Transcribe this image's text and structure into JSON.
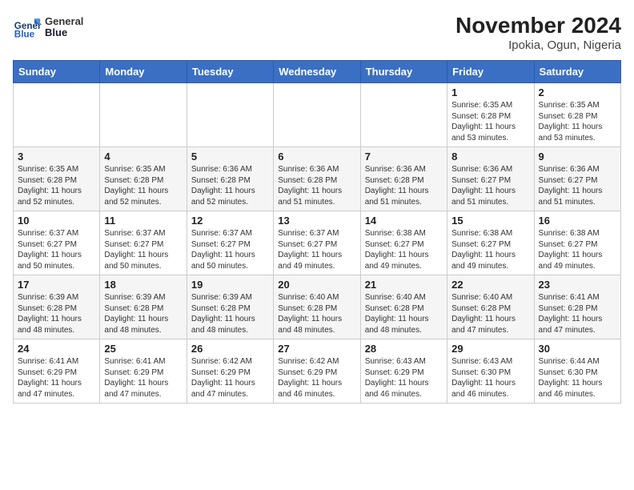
{
  "header": {
    "logo_line1": "General",
    "logo_line2": "Blue",
    "month_title": "November 2024",
    "location": "Ipokia, Ogun, Nigeria"
  },
  "weekdays": [
    "Sunday",
    "Monday",
    "Tuesday",
    "Wednesday",
    "Thursday",
    "Friday",
    "Saturday"
  ],
  "weeks": [
    [
      {
        "day": "",
        "info": ""
      },
      {
        "day": "",
        "info": ""
      },
      {
        "day": "",
        "info": ""
      },
      {
        "day": "",
        "info": ""
      },
      {
        "day": "",
        "info": ""
      },
      {
        "day": "1",
        "info": "Sunrise: 6:35 AM\nSunset: 6:28 PM\nDaylight: 11 hours\nand 53 minutes."
      },
      {
        "day": "2",
        "info": "Sunrise: 6:35 AM\nSunset: 6:28 PM\nDaylight: 11 hours\nand 53 minutes."
      }
    ],
    [
      {
        "day": "3",
        "info": "Sunrise: 6:35 AM\nSunset: 6:28 PM\nDaylight: 11 hours\nand 52 minutes."
      },
      {
        "day": "4",
        "info": "Sunrise: 6:35 AM\nSunset: 6:28 PM\nDaylight: 11 hours\nand 52 minutes."
      },
      {
        "day": "5",
        "info": "Sunrise: 6:36 AM\nSunset: 6:28 PM\nDaylight: 11 hours\nand 52 minutes."
      },
      {
        "day": "6",
        "info": "Sunrise: 6:36 AM\nSunset: 6:28 PM\nDaylight: 11 hours\nand 51 minutes."
      },
      {
        "day": "7",
        "info": "Sunrise: 6:36 AM\nSunset: 6:28 PM\nDaylight: 11 hours\nand 51 minutes."
      },
      {
        "day": "8",
        "info": "Sunrise: 6:36 AM\nSunset: 6:27 PM\nDaylight: 11 hours\nand 51 minutes."
      },
      {
        "day": "9",
        "info": "Sunrise: 6:36 AM\nSunset: 6:27 PM\nDaylight: 11 hours\nand 51 minutes."
      }
    ],
    [
      {
        "day": "10",
        "info": "Sunrise: 6:37 AM\nSunset: 6:27 PM\nDaylight: 11 hours\nand 50 minutes."
      },
      {
        "day": "11",
        "info": "Sunrise: 6:37 AM\nSunset: 6:27 PM\nDaylight: 11 hours\nand 50 minutes."
      },
      {
        "day": "12",
        "info": "Sunrise: 6:37 AM\nSunset: 6:27 PM\nDaylight: 11 hours\nand 50 minutes."
      },
      {
        "day": "13",
        "info": "Sunrise: 6:37 AM\nSunset: 6:27 PM\nDaylight: 11 hours\nand 49 minutes."
      },
      {
        "day": "14",
        "info": "Sunrise: 6:38 AM\nSunset: 6:27 PM\nDaylight: 11 hours\nand 49 minutes."
      },
      {
        "day": "15",
        "info": "Sunrise: 6:38 AM\nSunset: 6:27 PM\nDaylight: 11 hours\nand 49 minutes."
      },
      {
        "day": "16",
        "info": "Sunrise: 6:38 AM\nSunset: 6:27 PM\nDaylight: 11 hours\nand 49 minutes."
      }
    ],
    [
      {
        "day": "17",
        "info": "Sunrise: 6:39 AM\nSunset: 6:28 PM\nDaylight: 11 hours\nand 48 minutes."
      },
      {
        "day": "18",
        "info": "Sunrise: 6:39 AM\nSunset: 6:28 PM\nDaylight: 11 hours\nand 48 minutes."
      },
      {
        "day": "19",
        "info": "Sunrise: 6:39 AM\nSunset: 6:28 PM\nDaylight: 11 hours\nand 48 minutes."
      },
      {
        "day": "20",
        "info": "Sunrise: 6:40 AM\nSunset: 6:28 PM\nDaylight: 11 hours\nand 48 minutes."
      },
      {
        "day": "21",
        "info": "Sunrise: 6:40 AM\nSunset: 6:28 PM\nDaylight: 11 hours\nand 48 minutes."
      },
      {
        "day": "22",
        "info": "Sunrise: 6:40 AM\nSunset: 6:28 PM\nDaylight: 11 hours\nand 47 minutes."
      },
      {
        "day": "23",
        "info": "Sunrise: 6:41 AM\nSunset: 6:28 PM\nDaylight: 11 hours\nand 47 minutes."
      }
    ],
    [
      {
        "day": "24",
        "info": "Sunrise: 6:41 AM\nSunset: 6:29 PM\nDaylight: 11 hours\nand 47 minutes."
      },
      {
        "day": "25",
        "info": "Sunrise: 6:41 AM\nSunset: 6:29 PM\nDaylight: 11 hours\nand 47 minutes."
      },
      {
        "day": "26",
        "info": "Sunrise: 6:42 AM\nSunset: 6:29 PM\nDaylight: 11 hours\nand 47 minutes."
      },
      {
        "day": "27",
        "info": "Sunrise: 6:42 AM\nSunset: 6:29 PM\nDaylight: 11 hours\nand 46 minutes."
      },
      {
        "day": "28",
        "info": "Sunrise: 6:43 AM\nSunset: 6:29 PM\nDaylight: 11 hours\nand 46 minutes."
      },
      {
        "day": "29",
        "info": "Sunrise: 6:43 AM\nSunset: 6:30 PM\nDaylight: 11 hours\nand 46 minutes."
      },
      {
        "day": "30",
        "info": "Sunrise: 6:44 AM\nSunset: 6:30 PM\nDaylight: 11 hours\nand 46 minutes."
      }
    ]
  ]
}
